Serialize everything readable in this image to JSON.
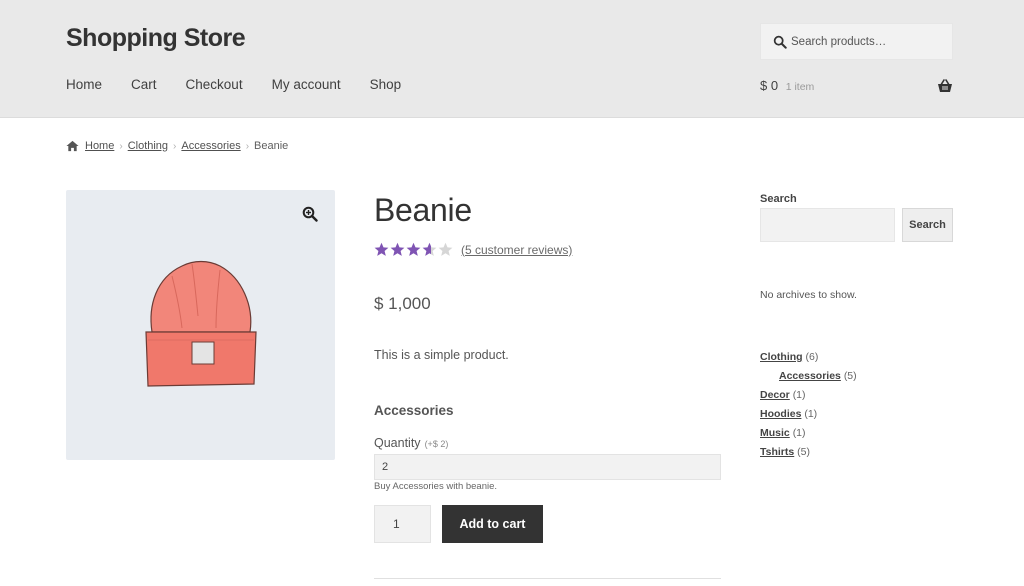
{
  "header": {
    "site_title": "Shopping Store",
    "search_placeholder": "Search products…",
    "nav": [
      "Home",
      "Cart",
      "Checkout",
      "My account",
      "Shop"
    ],
    "cart_total": "$ 0",
    "cart_count": "1 item"
  },
  "breadcrumb": {
    "items": [
      "Home",
      "Clothing",
      "Accessories"
    ],
    "current": "Beanie"
  },
  "product": {
    "title": "Beanie",
    "rating": 3.6,
    "rating_max": 5,
    "reviews_text": "(5 customer reviews)",
    "price": "$ 1,000",
    "short_description": "This is a simple product.",
    "addon_title": "Accessories",
    "qty_label": "Quantity",
    "qty_extra": "(+$ 2)",
    "addon_value": "2",
    "addon_help": "Buy Accessories with beanie.",
    "cart_qty": "1",
    "add_to_cart": "Add to cart"
  },
  "sidebar": {
    "search_title": "Search",
    "search_button": "Search",
    "no_archives": "No archives to show.",
    "categories": [
      {
        "name": "Clothing",
        "count": "(6)",
        "sub": false
      },
      {
        "name": "Accessories",
        "count": "(5)",
        "sub": true
      },
      {
        "name": "Decor",
        "count": "(1)",
        "sub": false
      },
      {
        "name": "Hoodies",
        "count": "(1)",
        "sub": false
      },
      {
        "name": "Music",
        "count": "(1)",
        "sub": false
      },
      {
        "name": "Tshirts",
        "count": "(5)",
        "sub": false
      }
    ]
  },
  "colors": {
    "header_bg": "#e9e9e9",
    "star": "#7f54b3",
    "star_empty": "#d6d6d6",
    "button_bg": "#333333"
  },
  "icons": [
    "search-icon",
    "basket-icon",
    "home-icon",
    "zoom-icon",
    "star-icon"
  ]
}
